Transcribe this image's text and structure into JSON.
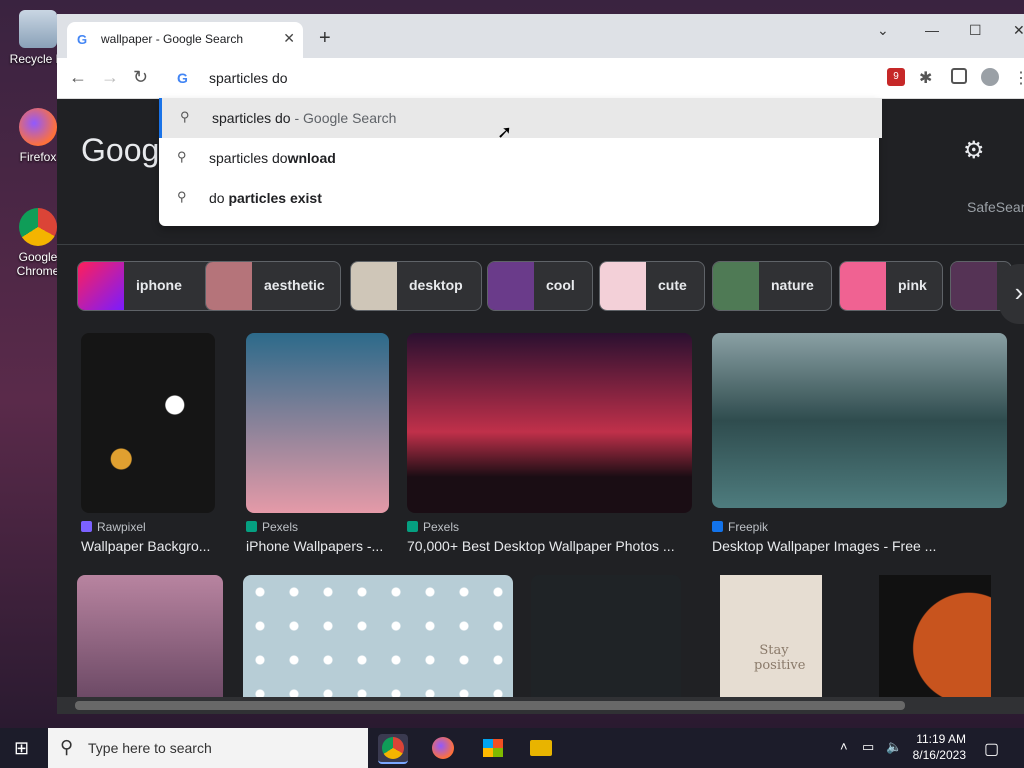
{
  "desktop": {
    "icons": [
      {
        "label": "Recycle Bi"
      },
      {
        "label": "Firefox"
      },
      {
        "label": "Google Chrome"
      }
    ]
  },
  "browser": {
    "tab_title": "wallpaper - Google Search",
    "new_tab": "+",
    "omnibox_value": "sparticles do",
    "suggestions": [
      {
        "prefix": "sparticles do",
        "bold": "",
        "suffix": " - Google Search",
        "selected": true
      },
      {
        "prefix": "sparticles do",
        "bold": "wnload",
        "suffix": "",
        "selected": false
      },
      {
        "prefix": "do ",
        "bold": "particles exist",
        "suffix": "",
        "selected": false
      }
    ],
    "extension_badge": "9"
  },
  "page": {
    "logo": "Googl",
    "safesearch": "SafeSear",
    "chips": [
      {
        "label": "iphone",
        "color": "#c2185b"
      },
      {
        "label": "aesthetic",
        "color": "#b5747a"
      },
      {
        "label": "desktop",
        "color": "#cfc6b8"
      },
      {
        "label": "cool",
        "color": "#6a3b8a"
      },
      {
        "label": "cute",
        "color": "#f3d0d8"
      },
      {
        "label": "nature",
        "color": "#4f7a55"
      },
      {
        "label": "pink",
        "color": "#f06292"
      }
    ],
    "results": [
      {
        "source": "Rawpixel",
        "title": "Wallpaper Backgro...",
        "src_color": "#7b61ff",
        "img_color": "#151515"
      },
      {
        "source": "Pexels",
        "title": "iPhone Wallpapers -...",
        "src_color": "#05a081",
        "img_color": "#2c6a8a"
      },
      {
        "source": "Pexels",
        "title": "70,000+ Best Desktop Wallpaper Photos ...",
        "src_color": "#05a081",
        "img_color": "#a0324a"
      },
      {
        "source": "Freepik",
        "title": "Desktop Wallpaper Images - Free ...",
        "src_color": "#1273eb",
        "img_color": "#3f5f66"
      }
    ],
    "row2_colors": [
      "#b884a0",
      "#b7cdd6",
      "#1f2326",
      "#e6ddd2",
      "#c8541e"
    ],
    "row2_text": "Stay positive"
  },
  "taskbar": {
    "search_placeholder": "Type here to search",
    "time": "11:19 AM",
    "date": "8/16/2023"
  }
}
